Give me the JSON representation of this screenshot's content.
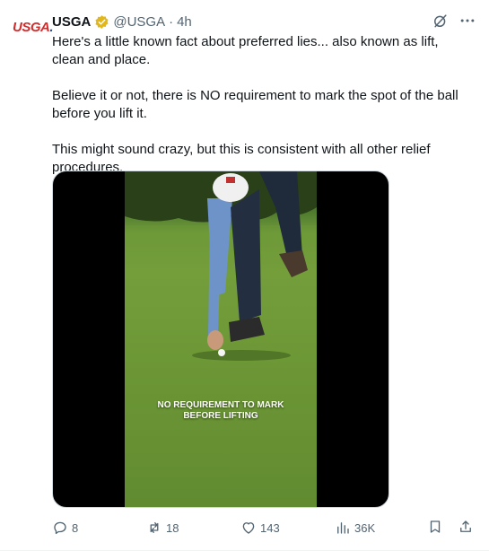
{
  "tweet": {
    "author_name": "USGA",
    "handle": "@USGA",
    "separator": "·",
    "time": "4h",
    "avatar_text": "USGA",
    "avatar_dot": ".",
    "paragraphs": [
      "Here's a little known fact about preferred lies... also known as lift, clean and place.",
      "Believe it or not, there is NO requirement to mark the spot of the ball before you lift it.",
      "This might sound crazy, but this is consistent with all other relief procedures."
    ],
    "media": {
      "caption_line1": "NO REQUIREMENT TO MARK",
      "caption_line2": "BEFORE LIFTING"
    },
    "actions": {
      "replies": "8",
      "reposts": "18",
      "likes": "143",
      "views": "36K"
    }
  },
  "icons": {
    "verified": "verified-badge-icon",
    "grok": "grok-icon",
    "more": "more-icon",
    "reply": "reply-icon",
    "repost": "repost-icon",
    "like": "heart-icon",
    "views": "views-chart-icon",
    "bookmark": "bookmark-icon",
    "share": "share-icon"
  },
  "colors": {
    "text": "#0f1419",
    "secondary": "#536471",
    "verified_gold": "#e2b719",
    "avatar_red": "#d42b2b",
    "avatar_blue": "#1d4f91"
  }
}
